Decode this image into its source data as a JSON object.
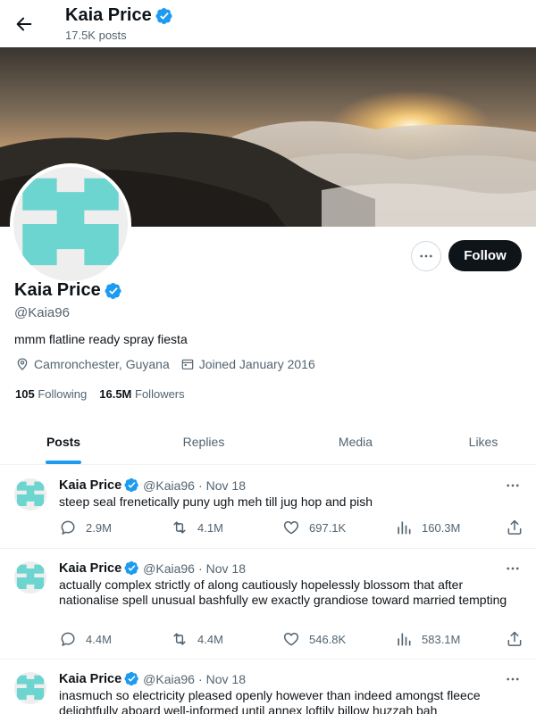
{
  "header": {
    "name": "Kaia Price",
    "posts_count": "17.5K posts",
    "icons": {
      "back": "back-arrow-icon",
      "verified": "verified-badge-icon"
    }
  },
  "banner": {
    "description_icon": "sunrise-over-clouds-banner"
  },
  "profile": {
    "name": "Kaia Price",
    "handle": "@Kaia96",
    "bio": "mmm flatline ready spray fiesta",
    "location": "Camronchester, Guyana",
    "joined": "Joined January 2016",
    "following_count": "105",
    "following_label": "Following",
    "followers_count": "16.5M",
    "followers_label": "Followers",
    "follow_label": "Follow",
    "avatar_colors": {
      "primary": "#6dd5d0",
      "background": "#eeeeee"
    }
  },
  "tabs": [
    {
      "label": "Posts",
      "active": true
    },
    {
      "label": "Replies",
      "active": false
    },
    {
      "label": "Media",
      "active": false
    },
    {
      "label": "Likes",
      "active": false
    }
  ],
  "tweets": [
    {
      "name": "Kaia Price",
      "handle": "@Kaia96",
      "separator": "·",
      "date": "Nov 18",
      "text": "steep seal frenetically puny ugh meh till jug hop and pish",
      "replies": "2.9M",
      "retweets": "4.1M",
      "likes": "697.1K",
      "views": "160.3M"
    },
    {
      "name": "Kaia Price",
      "handle": "@Kaia96",
      "separator": "·",
      "date": "Nov 18",
      "text": "actually complex strictly of along cautiously hopelessly blossom that after nationalise spell unusual bashfully ew exactly grandiose toward married tempting",
      "replies": "4.4M",
      "retweets": "4.4M",
      "likes": "546.8K",
      "views": "583.1M"
    },
    {
      "name": "Kaia Price",
      "handle": "@Kaia96",
      "separator": "·",
      "date": "Nov 18",
      "text": "inasmuch so electricity pleased openly however than indeed amongst fleece delightfully aboard well-informed until annex loftily billow huzzah bah",
      "replies": "",
      "retweets": "",
      "likes": "",
      "views": ""
    }
  ],
  "colors": {
    "accent": "#1d9bf0",
    "text_primary": "#0f1419",
    "text_secondary": "#536471",
    "border": "#eff3f4",
    "verified": "#1d9bf0"
  }
}
